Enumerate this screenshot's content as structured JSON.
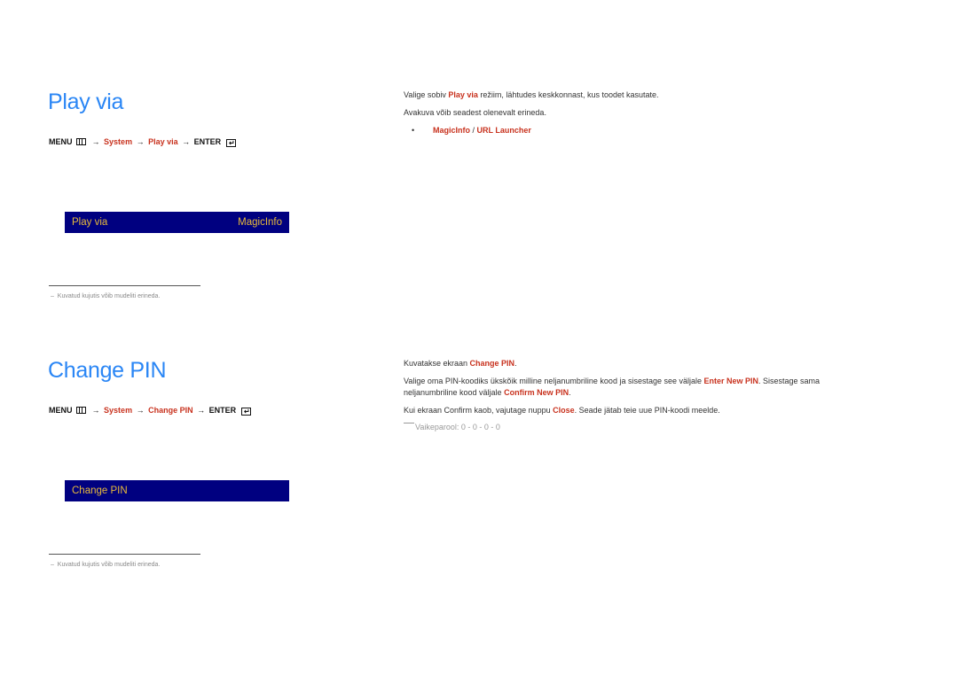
{
  "sections": {
    "play_via": {
      "title": "Play via",
      "menu_path": {
        "menu": "MENU",
        "arrow": "→",
        "system": "System",
        "item": "Play via",
        "enter": "ENTER"
      },
      "osd": {
        "label": "Play via",
        "value": "MagicInfo"
      },
      "footnote": "Kuvatud kujutis võib mudeliti erineda.",
      "footnote_dash": "–",
      "description": {
        "line1_pre": "Valige sobiv ",
        "line1_hl": "Play via",
        "line1_post": " režiim, lähtudes keskkonnast, kus toodet kasutate.",
        "line2": "Avakuva võib seadest olenevalt erineda.",
        "bullet": "•",
        "options": [
          "MagicInfo",
          "URL Launcher"
        ],
        "options_sep": " / "
      }
    },
    "change_pin": {
      "title": "Change PIN",
      "menu_path": {
        "menu": "MENU",
        "arrow": "→",
        "system": "System",
        "item": "Change PIN",
        "enter": "ENTER"
      },
      "osd": {
        "label": "Change PIN"
      },
      "footnote": "Kuvatud kujutis võib mudeliti erineda.",
      "footnote_dash": "–",
      "description": {
        "p1_pre": "Kuvatakse ekraan ",
        "p1_hl": "Change PIN",
        "p1_post": ".",
        "p2_pre": "Valige oma PIN-koodiks ükskõik milline neljanumbriline kood ja sisestage see väljale ",
        "p2_hl1": "Enter New PIN",
        "p2_mid": ". Sisestage sama neljanumbriline kood väljale ",
        "p2_hl2": "Confirm New PIN",
        "p2_post": ".",
        "p3_pre": "Kui ekraan Confirm kaob, vajutage nuppu ",
        "p3_hl": "Close",
        "p3_post": ". Seade jätab teie uue PIN-koodi meelde.",
        "note": "Vaikeparool: 0 - 0 - 0 - 0"
      }
    }
  }
}
